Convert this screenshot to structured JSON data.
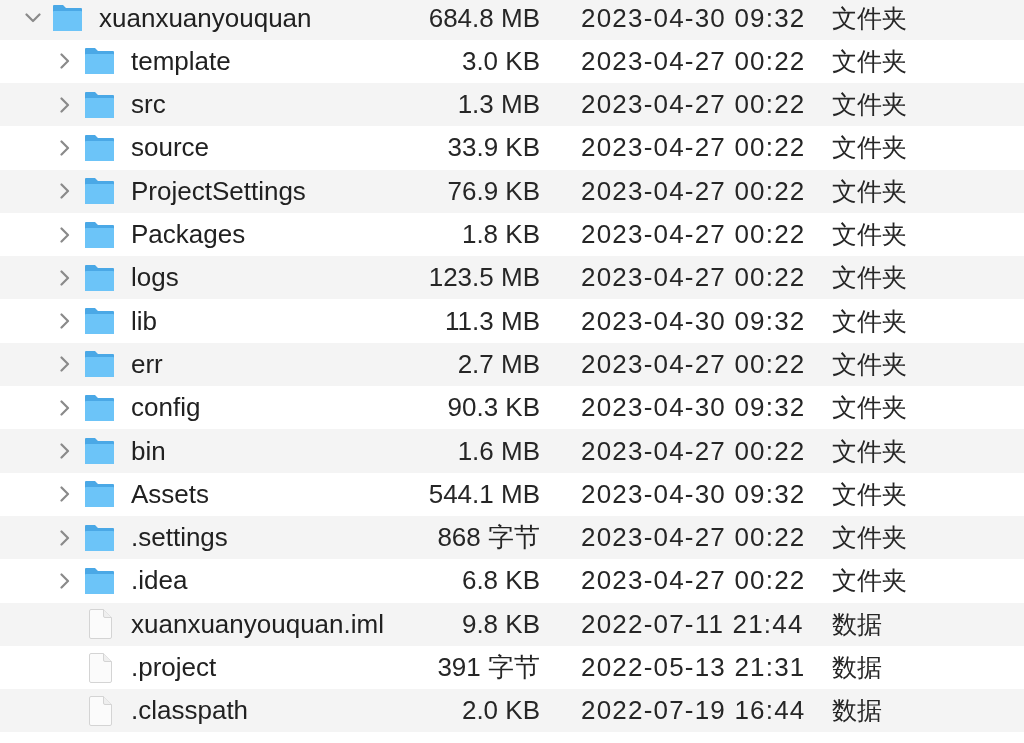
{
  "tree": {
    "kind": "folder",
    "name": "xuanxuanyouquan",
    "size": "684.8 MB",
    "date_modified": "2023-04-30 09:32",
    "kind_label": "文件夹",
    "expanded": true,
    "children": [
      {
        "kind": "folder",
        "name": "template",
        "size": "3.0 KB",
        "date_modified": "2023-04-27 00:22",
        "kind_label": "文件夹",
        "expanded": false
      },
      {
        "kind": "folder",
        "name": "src",
        "size": "1.3 MB",
        "date_modified": "2023-04-27 00:22",
        "kind_label": "文件夹",
        "expanded": false
      },
      {
        "kind": "folder",
        "name": "source",
        "size": "33.9 KB",
        "date_modified": "2023-04-27 00:22",
        "kind_label": "文件夹",
        "expanded": false
      },
      {
        "kind": "folder",
        "name": "ProjectSettings",
        "size": "76.9 KB",
        "date_modified": "2023-04-27 00:22",
        "kind_label": "文件夹",
        "expanded": false
      },
      {
        "kind": "folder",
        "name": "Packages",
        "size": "1.8 KB",
        "date_modified": "2023-04-27 00:22",
        "kind_label": "文件夹",
        "expanded": false
      },
      {
        "kind": "folder",
        "name": "logs",
        "size": "123.5 MB",
        "date_modified": "2023-04-27 00:22",
        "kind_label": "文件夹",
        "expanded": false
      },
      {
        "kind": "folder",
        "name": "lib",
        "size": "11.3 MB",
        "date_modified": "2023-04-30 09:32",
        "kind_label": "文件夹",
        "expanded": false
      },
      {
        "kind": "folder",
        "name": "err",
        "size": "2.7 MB",
        "date_modified": "2023-04-27 00:22",
        "kind_label": "文件夹",
        "expanded": false
      },
      {
        "kind": "folder",
        "name": "config",
        "size": "90.3 KB",
        "date_modified": "2023-04-30 09:32",
        "kind_label": "文件夹",
        "expanded": false
      },
      {
        "kind": "folder",
        "name": "bin",
        "size": "1.6 MB",
        "date_modified": "2023-04-27 00:22",
        "kind_label": "文件夹",
        "expanded": false
      },
      {
        "kind": "folder",
        "name": "Assets",
        "size": "544.1 MB",
        "date_modified": "2023-04-30 09:32",
        "kind_label": "文件夹",
        "expanded": false
      },
      {
        "kind": "folder",
        "name": ".settings",
        "size": "868 字节",
        "date_modified": "2023-04-27 00:22",
        "kind_label": "文件夹",
        "expanded": false
      },
      {
        "kind": "folder",
        "name": ".idea",
        "size": "6.8 KB",
        "date_modified": "2023-04-27 00:22",
        "kind_label": "文件夹",
        "expanded": false
      },
      {
        "kind": "file",
        "name": "xuanxuanyouquan.iml",
        "size": "9.8 KB",
        "date_modified": "2022-07-11 21:44",
        "kind_label": "数据"
      },
      {
        "kind": "file",
        "name": ".project",
        "size": "391 字节",
        "date_modified": "2022-05-13 21:31",
        "kind_label": "数据"
      },
      {
        "kind": "file",
        "name": ".classpath",
        "size": "2.0 KB",
        "date_modified": "2022-07-19 16:44",
        "kind_label": "数据"
      }
    ]
  }
}
